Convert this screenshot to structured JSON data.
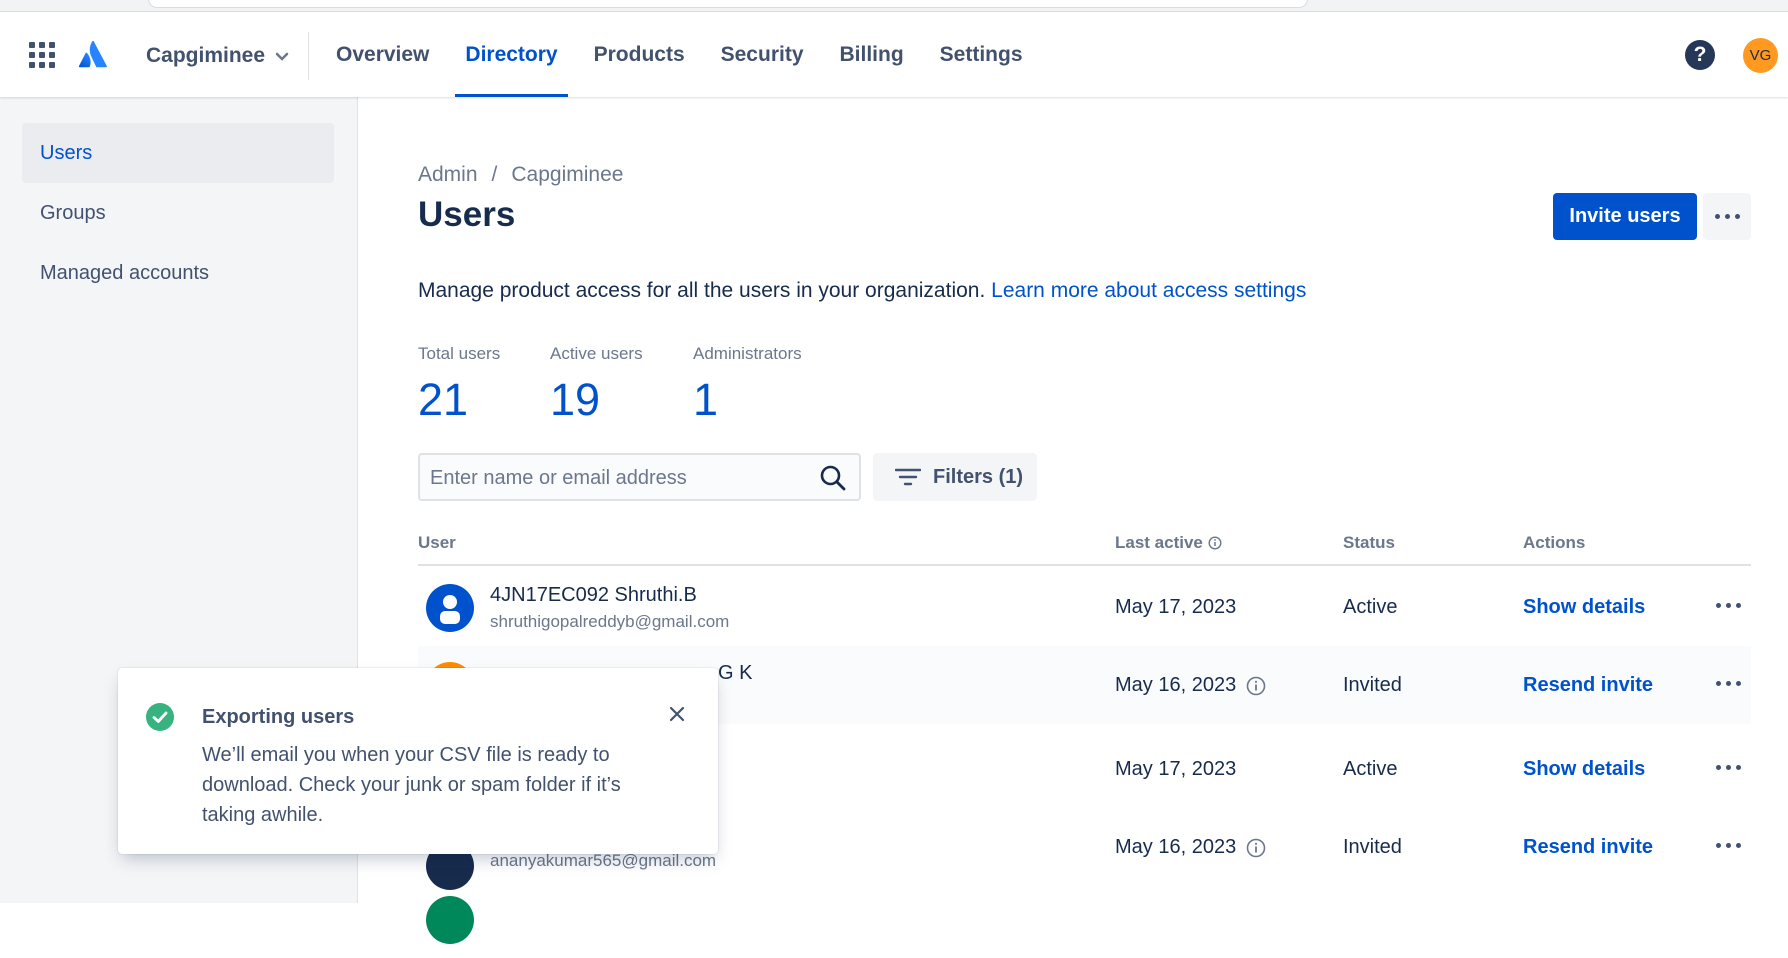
{
  "topbar": {
    "org_name": "Capgiminee",
    "nav": [
      {
        "label": "Overview"
      },
      {
        "label": "Directory"
      },
      {
        "label": "Products"
      },
      {
        "label": "Security"
      },
      {
        "label": "Billing"
      },
      {
        "label": "Settings"
      }
    ],
    "active_nav": "Directory",
    "help_glyph": "?",
    "avatar_initials": "VG"
  },
  "sidebar": {
    "items": [
      {
        "label": "Users"
      },
      {
        "label": "Groups"
      },
      {
        "label": "Managed accounts"
      }
    ],
    "active": "Users"
  },
  "main": {
    "breadcrumb": [
      "Admin",
      "Capgiminee"
    ],
    "breadcrumb_sep": "/",
    "title": "Users",
    "invite_label": "Invite users",
    "description": "Manage product access for all the users in your organization.",
    "learn_more": "Learn more about access settings",
    "stats": [
      {
        "label": "Total users",
        "value": "21"
      },
      {
        "label": "Active users",
        "value": "19"
      },
      {
        "label": "Administrators",
        "value": "1"
      }
    ],
    "search_placeholder": "Enter name or email address",
    "filters_label": "Filters (1)",
    "columns": {
      "user": "User",
      "last_active": "Last active",
      "status": "Status",
      "actions": "Actions"
    },
    "rows": [
      {
        "name": "4JN17EC092 Shruthi.B",
        "email": "shruthigopalreddyb@gmail.com",
        "last_active": "May 17, 2023",
        "status": "Active",
        "action": "Show details",
        "avatar_color": "#0052cc"
      },
      {
        "name": "G K",
        "email": "",
        "last_active": "May 16, 2023",
        "status": "Invited",
        "action": "Resend invite",
        "avatar_color": "#ff8b00"
      },
      {
        "name": "",
        "email": "",
        "last_active": "May 17, 2023",
        "status": "Active",
        "action": "Show details",
        "avatar_color": "#00875a"
      },
      {
        "name": "",
        "email": "ananyakumar565@gmail.com",
        "last_active": "May 16, 2023",
        "status": "Invited",
        "action": "Resend invite",
        "avatar_color": "#172b4d"
      }
    ]
  },
  "toast": {
    "title": "Exporting users",
    "body": "We’ll email you when your CSV file is ready to download. Check your junk or spam folder if it’s taking awhile."
  },
  "colors": {
    "primary": "#0052cc",
    "success": "#36b37e",
    "text": "#172b4d",
    "subtle": "#6b778c"
  }
}
